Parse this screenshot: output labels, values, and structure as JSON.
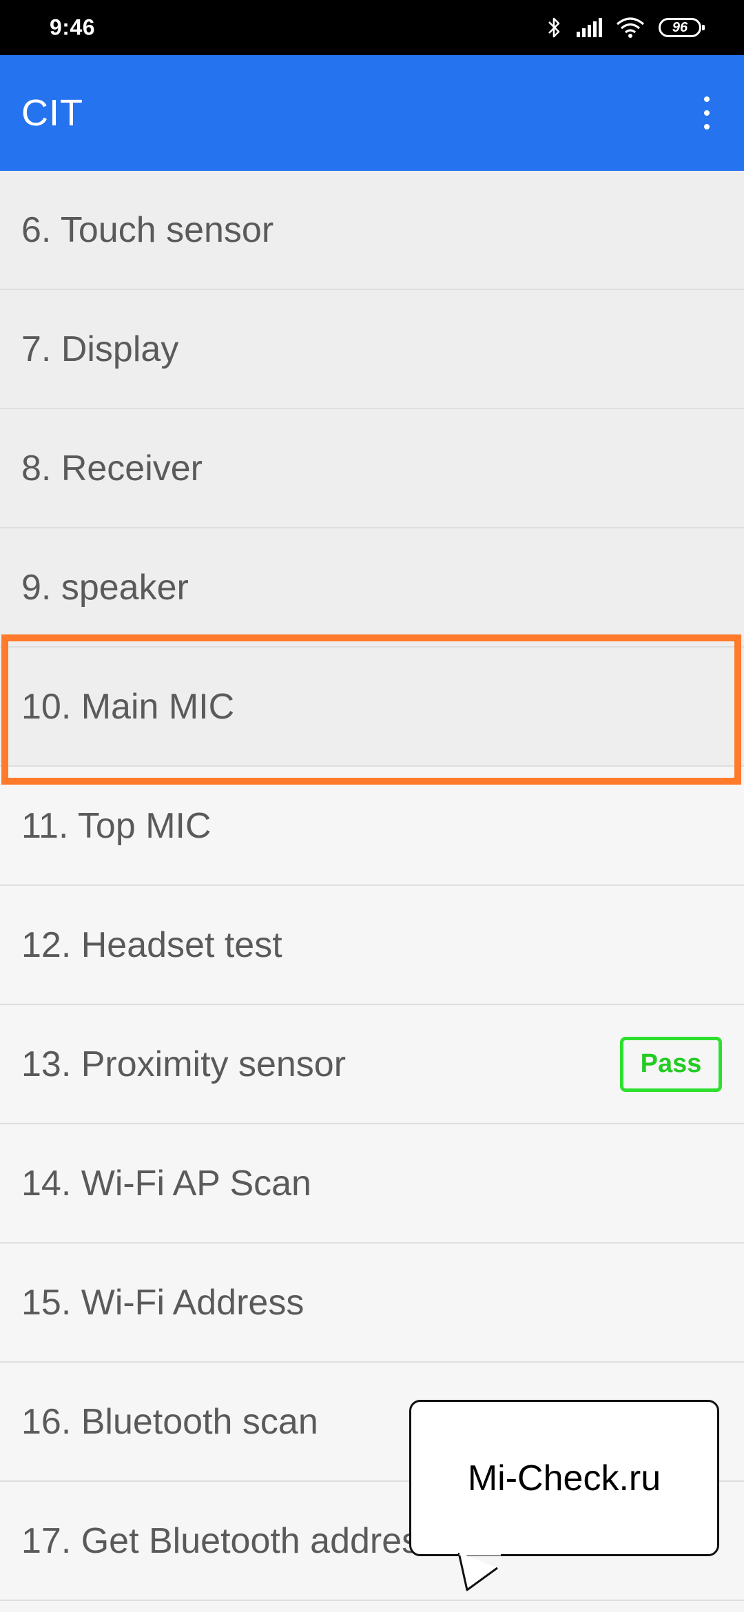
{
  "status_bar": {
    "time": "9:46",
    "battery": "96",
    "icons": [
      "bluetooth-icon",
      "signal-icon",
      "wifi-icon",
      "battery-icon"
    ]
  },
  "app_bar": {
    "title": "CIT",
    "menu_icon": "more-vert-icon"
  },
  "tests": [
    {
      "label": "6. Touch sensor"
    },
    {
      "label": "7. Display"
    },
    {
      "label": "8. Receiver"
    },
    {
      "label": "9. speaker"
    },
    {
      "label": "10. Main MIC",
      "highlighted": true
    },
    {
      "label": "11. Top MIC"
    },
    {
      "label": "12. Headset test"
    },
    {
      "label": "13. Proximity sensor",
      "status": "Pass"
    },
    {
      "label": "14. Wi-Fi AP Scan"
    },
    {
      "label": "15. Wi-Fi Address"
    },
    {
      "label": "16. Bluetooth scan"
    },
    {
      "label": "17. Get Bluetooth address"
    }
  ],
  "callout": {
    "text": "Mi-Check.ru"
  },
  "colors": {
    "app_bar": "#2673ef",
    "highlight": "#ff7a2a",
    "pass": "#2ee02e"
  }
}
